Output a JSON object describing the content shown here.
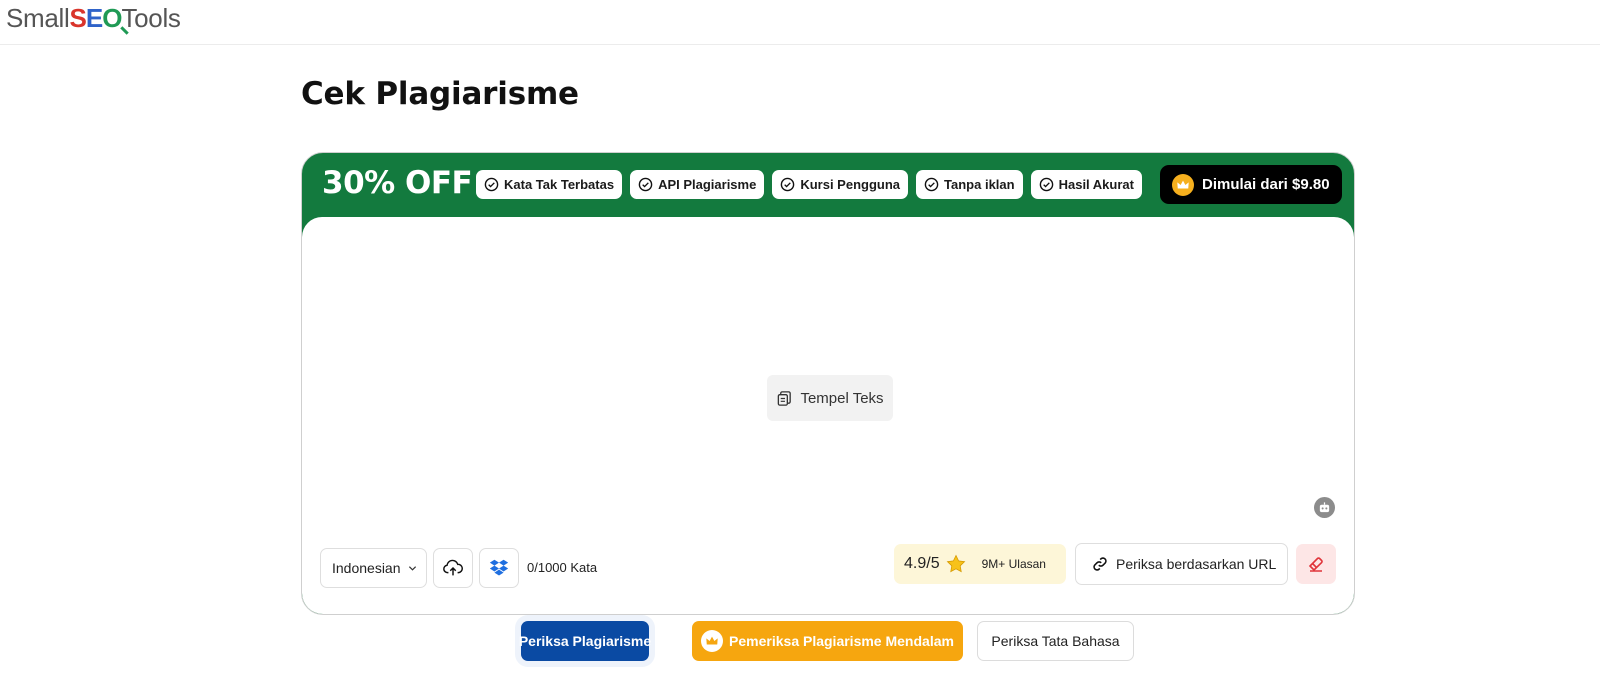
{
  "header": {
    "logo_prefix": "Small",
    "logo_seo_s": "S",
    "logo_seo_e": "E",
    "logo_seo_o": "O",
    "logo_suffix": "Tools"
  },
  "page": {
    "title": "Cek Plagiarisme"
  },
  "promo": {
    "discount": "30% OFF",
    "features": [
      "Kata Tak Terbatas",
      "API Plagiarisme",
      "Kursi Pengguna",
      "Tanpa iklan",
      "Hasil Akurat"
    ],
    "cta": "Dimulai dari $9.80",
    "bg_color": "#137a3e"
  },
  "editor": {
    "paste_label": "Tempel Teks",
    "language": "Indonesian",
    "word_count": "0/1000 Kata",
    "rating": "4.9/5",
    "reviews": "9M+ Ulasan",
    "url_check_label": "Periksa berdasarkan URL"
  },
  "actions": {
    "check_label": "Periksa Plagiarisme",
    "deep_check_label": "Pemeriksa Plagiarisme Mendalam",
    "grammar_label": "Periksa Tata Bahasa",
    "primary_color": "#0a4aa3",
    "deep_color": "#f6a60f"
  },
  "icons": {
    "check": "check-circle-icon",
    "crown": "crown-icon",
    "paste": "clipboard-icon",
    "bot": "bot-icon",
    "upload": "cloud-upload-icon",
    "dropbox": "dropbox-icon",
    "star": "star-icon",
    "link": "link-icon",
    "eraser": "eraser-icon",
    "chevron": "chevron-down-icon"
  }
}
